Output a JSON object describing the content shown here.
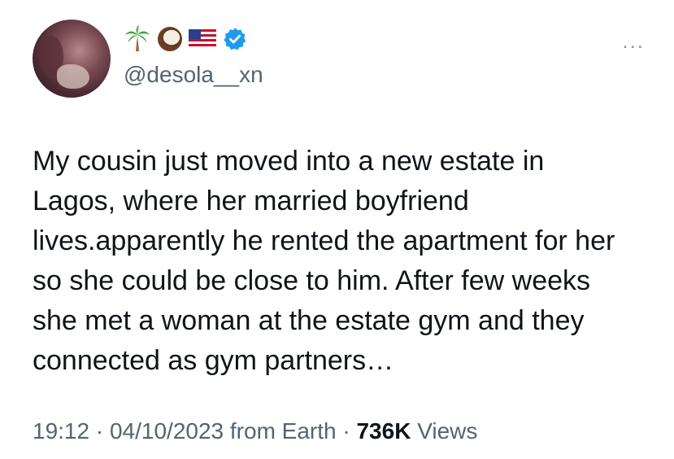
{
  "author": {
    "handle": "@desola__xn",
    "name_emojis": [
      "palm-tree",
      "coconut",
      "us-flag"
    ],
    "verified": true
  },
  "more_menu": {
    "label": "..."
  },
  "tweet": {
    "text": "My cousin just moved into a new estate in Lagos, where her married boyfriend lives.apparently he rented the apartment for her so she could be close to him. After few weeks she met a woman at the estate gym and they connected as gym partners…"
  },
  "meta": {
    "time": "19:12",
    "separator": " · ",
    "date": "04/10/2023",
    "source": "from Earth",
    "views_count": "736K",
    "views_label": "Views"
  },
  "colors": {
    "text_primary": "#0f1419",
    "text_secondary": "#536471",
    "verified_blue": "#1d9bf0"
  }
}
